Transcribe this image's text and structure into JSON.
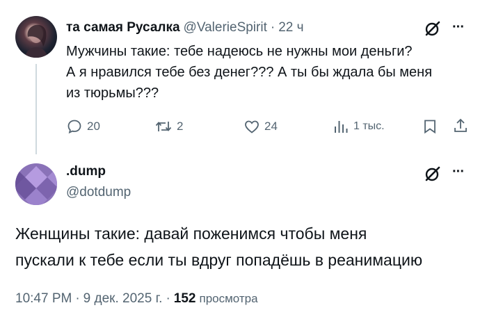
{
  "reply_tweet": {
    "display_name": "та самая Русалка",
    "handle": "@ValerieSpirit",
    "separator": "·",
    "time_ago": "22 ч",
    "text_line1": "Мужчины такие:  тебе надеюсь не нужны мои деньги?",
    "text_line2": "А я нравился тебе без денег??? А ты бы ждала бы меня",
    "text_line3": "из тюрьмы???",
    "replies": "20",
    "reposts": "2",
    "likes": "24",
    "views": "1 тыс.",
    "more_label": "···"
  },
  "main_tweet": {
    "display_name": ".dump",
    "handle": "@dotdump",
    "more_label": "···",
    "text_line1": "Женщины такие: давай поженимся чтобы меня",
    "text_line2": "пускали к тебе если ты вдруг попадёшь в реанимацию",
    "time": "10:47 PM",
    "separator1": "·",
    "date": "9 дек. 2025 г.",
    "separator2": "·",
    "views_count": "152",
    "views_label": "просмотра"
  },
  "icons": {
    "grok": "grok-icon",
    "more": "more-icon",
    "reply": "reply-icon",
    "repost": "repost-icon",
    "like": "like-icon",
    "views": "views-icon",
    "bookmark": "bookmark-icon",
    "share": "share-icon"
  },
  "colors": {
    "text": "#0f1419",
    "muted": "#536471",
    "avatar2_base": "#8a72b8"
  }
}
